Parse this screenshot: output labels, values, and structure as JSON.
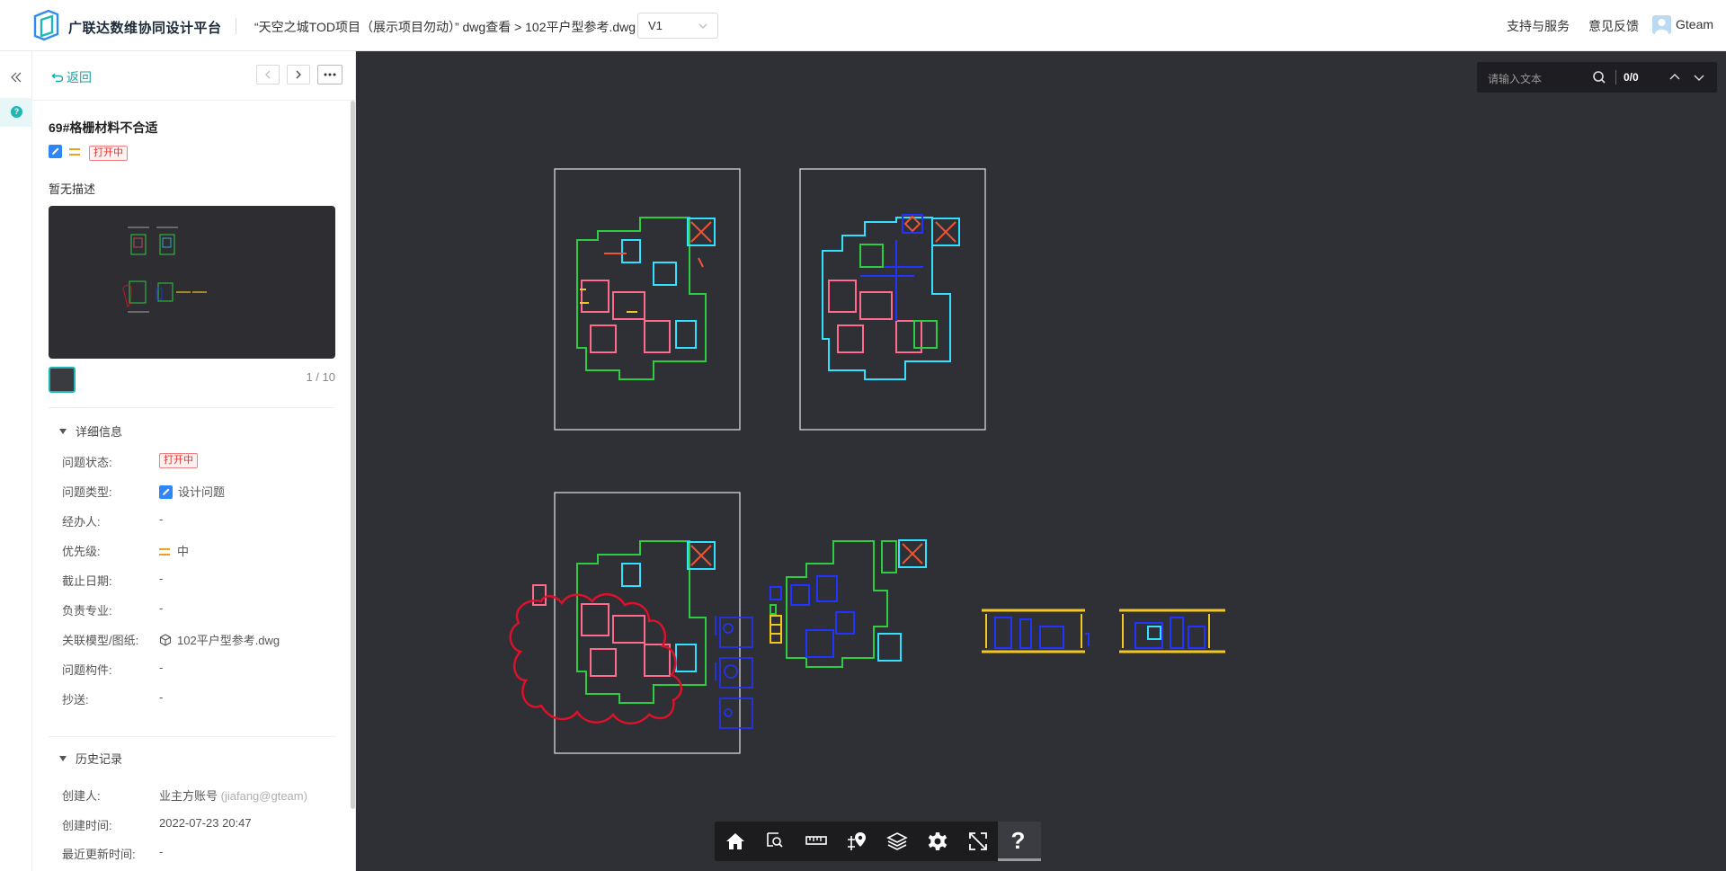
{
  "header": {
    "brand": "广联达数维协同设计平台",
    "breadcrumb": "“天空之城TOD项目（展示项目勿动）” dwg查看 > 102平户型参考.dwg",
    "version": "V1",
    "support_link": "支持与服务",
    "feedback_link": "意见反馈",
    "user_name": "Gteam"
  },
  "panel": {
    "back_label": "返回",
    "issue_title": "69#格栅材料不合适",
    "status_tag": "打开中",
    "description": "暂无描述",
    "pager": "1 / 10",
    "details_section": "详细信息",
    "details": [
      {
        "label": "问题状态:",
        "value": "打开中"
      },
      {
        "label": "问题类型:",
        "value": "设计问题"
      },
      {
        "label": "经办人:",
        "value": "-"
      },
      {
        "label": "优先级:",
        "value": "中"
      },
      {
        "label": "截止日期:",
        "value": "-"
      },
      {
        "label": "负责专业:",
        "value": "-"
      },
      {
        "label": "关联模型/图纸:",
        "value": "102平户型参考.dwg"
      },
      {
        "label": "问题构件:",
        "value": "-"
      },
      {
        "label": "抄送:",
        "value": "-"
      }
    ],
    "history_section": "历史记录",
    "history": [
      {
        "label": "创建人:",
        "value": "业主方账号",
        "extra": "(jiafang@gteam)"
      },
      {
        "label": "创建时间:",
        "value": "2022-07-23 20:47"
      },
      {
        "label": "最近更新时间:",
        "value": "-"
      }
    ]
  },
  "viewer": {
    "search_placeholder": "请输入文本",
    "search_count": "0/0",
    "help_label": "?"
  },
  "colors": {
    "accent": "#1fb7b5",
    "canvas_bg": "#2f3035",
    "status_red": "#e03030",
    "priority_orange": "#f0a01e"
  }
}
